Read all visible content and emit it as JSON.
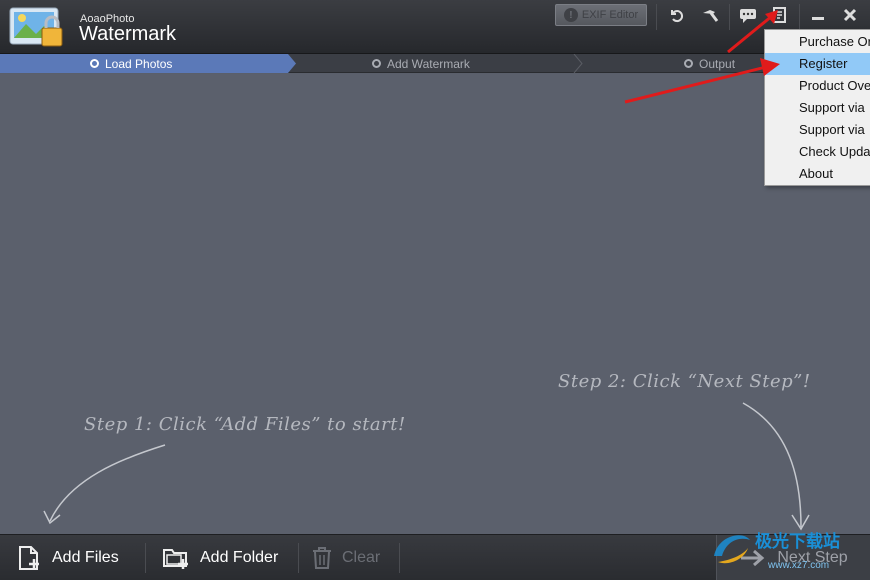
{
  "app": {
    "subtitle": "AoaoPhoto",
    "title": "Watermark"
  },
  "toolbar": {
    "exif_label": "EXIF Editor"
  },
  "steps": [
    {
      "label": "Load Photos",
      "active": true
    },
    {
      "label": "Add Watermark",
      "active": false
    },
    {
      "label": "Output",
      "active": false
    }
  ],
  "hints": {
    "step1": "Step 1: Click “Add Files” to start!",
    "step2": "Step 2: Click “Next Step”!"
  },
  "bottom": {
    "add_files": "Add Files",
    "add_folder": "Add Folder",
    "clear": "Clear",
    "next_step": "Next Step"
  },
  "menu": {
    "items": [
      {
        "label": "Purchase Or"
      },
      {
        "label": "Register",
        "highlighted": true
      },
      {
        "label": "Product Ove"
      },
      {
        "label": "Support via"
      },
      {
        "label": "Support via"
      },
      {
        "label": "Check Upda"
      },
      {
        "label": "About"
      }
    ]
  },
  "watermark": {
    "text": "极光下载站",
    "url": "www.xz7.com"
  },
  "colors": {
    "accent_arrow": "#e01b1b",
    "step_active": "#5b79b8",
    "menu_highlight": "#91c9f7"
  },
  "icons": [
    "logo-icon",
    "exclamation-icon",
    "undo-icon",
    "hammer-icon",
    "chat-icon",
    "menu-list-icon",
    "minimize-icon",
    "close-icon",
    "add-file-icon",
    "add-folder-icon",
    "trash-icon",
    "next-arrow-icon"
  ]
}
